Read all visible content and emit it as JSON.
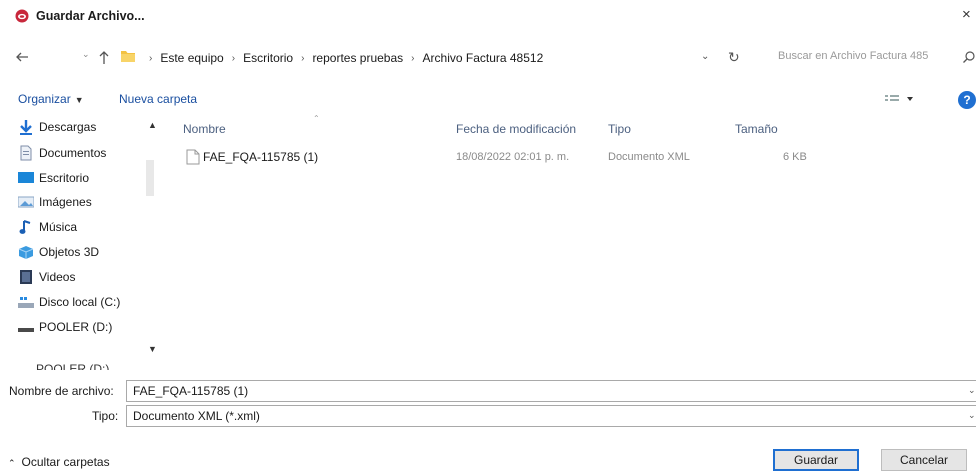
{
  "window": {
    "title": "Guardar Archivo...",
    "close_glyph": "×",
    "accent": "#1f6fd1",
    "icon": "app-logo-icon"
  },
  "address_bar": {
    "breadcrumbs": [
      "Este equipo",
      "Escritorio",
      "reportes pruebas",
      "Archivo Factura 48512"
    ],
    "search_placeholder": "Buscar en Archivo Factura 485"
  },
  "toolbar": {
    "organize_label": "Organizar",
    "new_folder_label": "Nueva carpeta",
    "help_label": "?"
  },
  "sidebar": {
    "items": [
      {
        "label": "Descargas",
        "icon": "download-arrow-icon"
      },
      {
        "label": "Documentos",
        "icon": "documents-icon"
      },
      {
        "label": "Escritorio",
        "icon": "desktop-icon"
      },
      {
        "label": "Imágenes",
        "icon": "pictures-icon"
      },
      {
        "label": "Música",
        "icon": "music-note-icon"
      },
      {
        "label": "Objetos 3D",
        "icon": "3d-objects-icon"
      },
      {
        "label": "Videos",
        "icon": "video-icon"
      },
      {
        "label": "Disco local (C:)",
        "icon": "local-disk-icon"
      },
      {
        "label": "POOLER (D:)",
        "icon": "drive-icon"
      }
    ],
    "cut_item": "POOLER (D:)"
  },
  "file_list": {
    "columns": {
      "name": "Nombre",
      "modified": "Fecha de modificación",
      "type": "Tipo",
      "size": "Tamaño"
    },
    "rows": [
      {
        "name": "FAE_FQA-115785 (1)",
        "modified": "18/08/2022 02:01 p. m.",
        "type": "Documento XML",
        "size": "6 KB"
      }
    ]
  },
  "fields": {
    "filename_label": "Nombre de archivo:",
    "filename_value": "FAE_FQA-115785 (1)",
    "type_label": "Tipo:",
    "type_value": "Documento XML (*.xml)"
  },
  "footer": {
    "hide_folders_label": "Ocultar carpetas",
    "save_label": "Guardar",
    "cancel_label": "Cancelar"
  }
}
